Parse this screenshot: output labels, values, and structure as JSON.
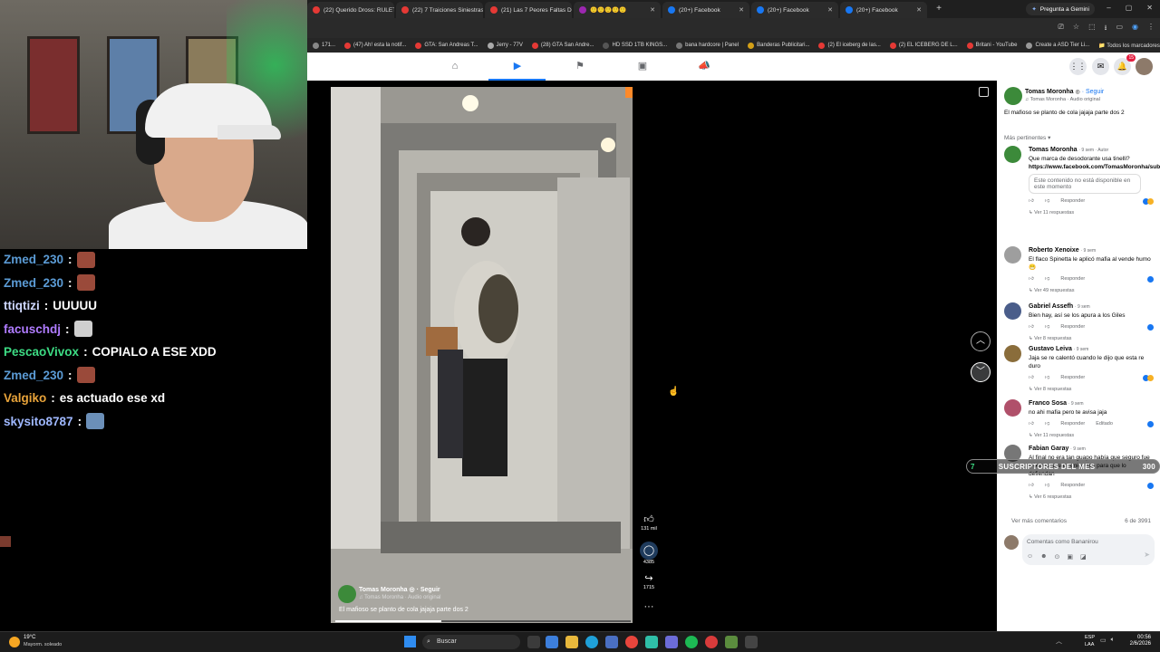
{
  "browser": {
    "tabs": [
      {
        "title": "(22) Querido Dross: RULET",
        "color": "#e53935"
      },
      {
        "title": "(22) 7 Traiciones Siniestras",
        "color": "#e53935"
      },
      {
        "title": "(21) Las 7 Peores Faltas De",
        "color": "#e53935"
      },
      {
        "title": "🙂🙂🙂🙂🙂",
        "color": "#9c27b0"
      },
      {
        "title": "(20+) Facebook",
        "color": "#1877f2"
      },
      {
        "title": "(20+) Facebook",
        "color": "#1877f2"
      },
      {
        "title": "(20+) Facebook",
        "color": "#1877f2"
      }
    ],
    "gemini_label": "Pregunta a Gemini",
    "bookmarks": [
      {
        "label": "171...",
        "color": "#888"
      },
      {
        "label": "(47) Ah! esta la notif...",
        "color": "#e53935"
      },
      {
        "label": "GTA: San Andreas T...",
        "color": "#e53935"
      },
      {
        "label": "Jerry - 77V",
        "color": "#aaa"
      },
      {
        "label": "(28) GTA San Andre...",
        "color": "#e53935"
      },
      {
        "label": "HD SSD 1TB KINGS...",
        "color": "#555"
      },
      {
        "label": "bana hardcore | Panel",
        "color": "#777"
      },
      {
        "label": "Banderas Publicitari...",
        "color": "#d4a017"
      },
      {
        "label": "(2) El iceberg de las...",
        "color": "#e53935"
      },
      {
        "label": "(2) EL ICEBERG DE L...",
        "color": "#e53935"
      },
      {
        "label": "Britani - YouTube",
        "color": "#e53935"
      },
      {
        "label": "Create a ASD Tier Li...",
        "color": "#999"
      }
    ],
    "all_bookmarks": "Todos los marcadores"
  },
  "fb": {
    "notif_count": "15",
    "video_author": "Tomas Moronha",
    "follow": "· Seguir",
    "audio": "Tomas Moronha · Audio original",
    "caption": "El mafioso se planto de cola jajaja parte dos 2",
    "likes": "131 mil",
    "comments_count": "4385",
    "shares": "1715",
    "progress_fraction": 0.36
  },
  "panel": {
    "author": "Tomas Moronha",
    "follow": "· Seguir",
    "audio": "Tomas Moronha · Audio original",
    "caption": "El mafioso se planto de cola jajaja parte dos 2",
    "sort": "Más pertinentes",
    "comments": [
      {
        "name": "Tomas Moronha",
        "meta": "· 9 sem · Autor",
        "text": "Que marca de desodorante usa tinelli?",
        "link": "https://www.facebook.com/TomasMoronha/subscribenow...",
        "unavailable": "Este contenido no está disponible en este momento",
        "reply": "Responder",
        "replies": "Ver 11 respuestas",
        "color": "#3c8a3a"
      },
      {
        "name": "Roberto Xenoixe",
        "meta": "· 9 sem",
        "text": "El flaco Spinetta le aplicó mafia al vende humo😁",
        "reply": "Responder",
        "replies": "Ver 49 respuestas",
        "color": "#9e9e9e"
      },
      {
        "name": "Gabriel Assefh",
        "meta": "· 9 sem",
        "text": "Bien hay, así se los apura a los Giles",
        "reply": "Responder",
        "replies": "Ver 8 respuestas",
        "color": "#4a5d8a"
      },
      {
        "name": "Gustavo Leiva",
        "meta": "· 9 sem",
        "text": "Jaja se re calentó cuando le dijo que esta re duro",
        "reply": "Responder",
        "replies": "Ver 8 respuestas",
        "color": "#8a6d3b"
      },
      {
        "name": "Franco Sosa",
        "meta": "· 9 sem",
        "text": "no ahi mafia pero te avisa jaja",
        "reply": "Responder",
        "edited": "Editado",
        "replies": "Ver 11 respuestas",
        "color": "#b0506a"
      },
      {
        "name": "Fabian Garay",
        "meta": "· 9 sem",
        "text": "Al final no era tan guapo había que seguro fue a buscar a sus amigovios para que lo defiendan",
        "reply": "Responder",
        "replies": "Ver 6 respuestas",
        "color": "#777"
      }
    ],
    "more_comments": "Ver más comentarios",
    "pager": "6 de 3991",
    "comment_placeholder": "Comentas como Bananirou"
  },
  "chat": [
    {
      "user": "Zmed_230",
      "color": "#5b9bd5",
      "msg": "",
      "emote": true
    },
    {
      "user": "Zmed_230",
      "color": "#5b9bd5",
      "msg": "",
      "emote": true
    },
    {
      "user": "ttiqtizi",
      "color": "#cfd8ff",
      "msg": "UUUUU",
      "emote": false
    },
    {
      "user": "facuschdj",
      "color": "#b07cff",
      "msg": "",
      "emote": true
    },
    {
      "user": "PescaoVivox",
      "color": "#3ddc84",
      "msg": "COPIALO A ESE XDD",
      "emote": false
    },
    {
      "user": "Zmed_230",
      "color": "#5b9bd5",
      "msg": "",
      "emote": true
    },
    {
      "user": "Valgiko",
      "color": "#e8a33a",
      "msg": "es actuado ese xd",
      "emote": false
    },
    {
      "user": "skysito8787",
      "color": "#9fb8ff",
      "msg": "",
      "emote": true
    }
  ],
  "overlay": {
    "subs_label": "SUSCRIPTORES DEL MES",
    "subs_count": "300",
    "subs_index": "7"
  },
  "taskbar": {
    "weather_temp": "19°C",
    "weather_desc": "Mayorm. soleado",
    "search": "Buscar",
    "lang": "ESP",
    "lang2": "LAA",
    "time": "00:56",
    "date": "2/6/2026"
  }
}
